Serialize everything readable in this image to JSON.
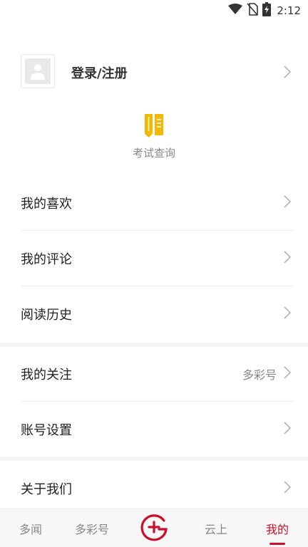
{
  "status_bar": {
    "time": "2:12",
    "icons": [
      "wifi-icon",
      "no-sim-icon",
      "battery-charging-icon"
    ]
  },
  "profile": {
    "login_label": "登录/注册",
    "avatar_icon": "person-placeholder-icon"
  },
  "exam": {
    "label": "考试查询",
    "icon": "exam-books-icon",
    "icon_color": "#f5b800"
  },
  "menu": {
    "favorites": "我的喜欢",
    "comments": "我的评论",
    "history": "阅读历史",
    "follows": "我的关注",
    "follows_extra": "多彩号",
    "account_settings": "账号设置",
    "about": "关于我们"
  },
  "bottom_nav": {
    "items": [
      {
        "label": "多闻"
      },
      {
        "label": "多彩号"
      },
      {
        "label": "",
        "icon": "add-circle-logo-icon"
      },
      {
        "label": "云上"
      },
      {
        "label": "我的"
      }
    ],
    "active_label": "我的",
    "accent_color": "#c8102e"
  }
}
